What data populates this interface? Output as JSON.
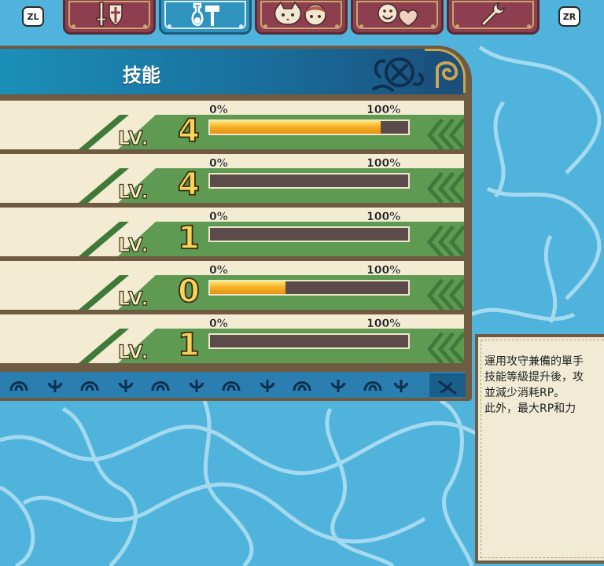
{
  "nav": {
    "left_button": "ZL",
    "right_button": "ZR",
    "tabs": [
      {
        "icon": "sword-shield-icon",
        "active": false
      },
      {
        "icon": "potion-hammer-icon",
        "active": true
      },
      {
        "icon": "companions-icon",
        "active": false
      },
      {
        "icon": "smile-heart-icon",
        "active": false
      },
      {
        "icon": "wrench-icon",
        "active": false
      }
    ]
  },
  "panel": {
    "title": "技能",
    "level_label": "LV.",
    "progress_min_label": "0%",
    "progress_max_label": "100%",
    "skills": [
      {
        "level": "4",
        "progress": 0.86
      },
      {
        "level": "4",
        "progress": 0.0
      },
      {
        "level": "1",
        "progress": 0.0
      },
      {
        "level": "0",
        "progress": 0.38
      },
      {
        "level": "1",
        "progress": 0.0
      }
    ]
  },
  "description": {
    "lines": [
      "運用攻守兼備的單手",
      "技能等級提升後，攻",
      "並減少消耗RP。",
      "此外，最大RP和力"
    ]
  },
  "colors": {
    "water": "#4fb3dc",
    "tab_inactive": "#8d3f4f",
    "tab_active": "#2f93bd",
    "row_bg": "#f3ecd2",
    "row_green": "#5e9a52",
    "bar_fill": "#f7b12a",
    "bar_track": "#5b4b4b"
  }
}
